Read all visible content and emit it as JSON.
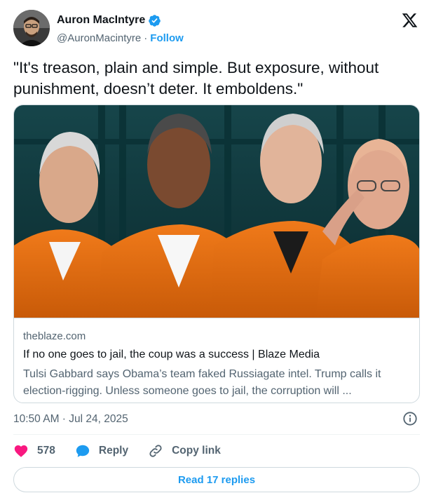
{
  "author": {
    "display_name": "Auron MacIntyre",
    "handle": "@AuronMacintyre",
    "separator": "·",
    "follow_label": "Follow",
    "verified": true
  },
  "tweet": {
    "text": "\"It's treason, plain and simple. But exposure, without punishment, doesn’t deter. It emboldens.\""
  },
  "card": {
    "domain": "theblaze.com",
    "title": "If no one goes to jail, the coup was a success | Blaze Media",
    "description": "Tulsi Gabbard says Obama’s team faked Russiagate intel. Trump calls it election-rigging. Unless someone goes to jail, the corruption will ..."
  },
  "meta": {
    "timestamp": "10:50 AM · Jul 24, 2025"
  },
  "actions": {
    "likes_count": "578",
    "reply_label": "Reply",
    "copy_link_label": "Copy link"
  },
  "read_replies_label": "Read 17 replies",
  "colors": {
    "accent": "#1d9bf0",
    "like": "#f91880",
    "text_secondary": "#536471",
    "border": "#cfd9de"
  },
  "icons": [
    "verified-badge-icon",
    "x-logo-icon",
    "heart-icon",
    "reply-bubble-icon",
    "link-icon",
    "info-icon"
  ]
}
